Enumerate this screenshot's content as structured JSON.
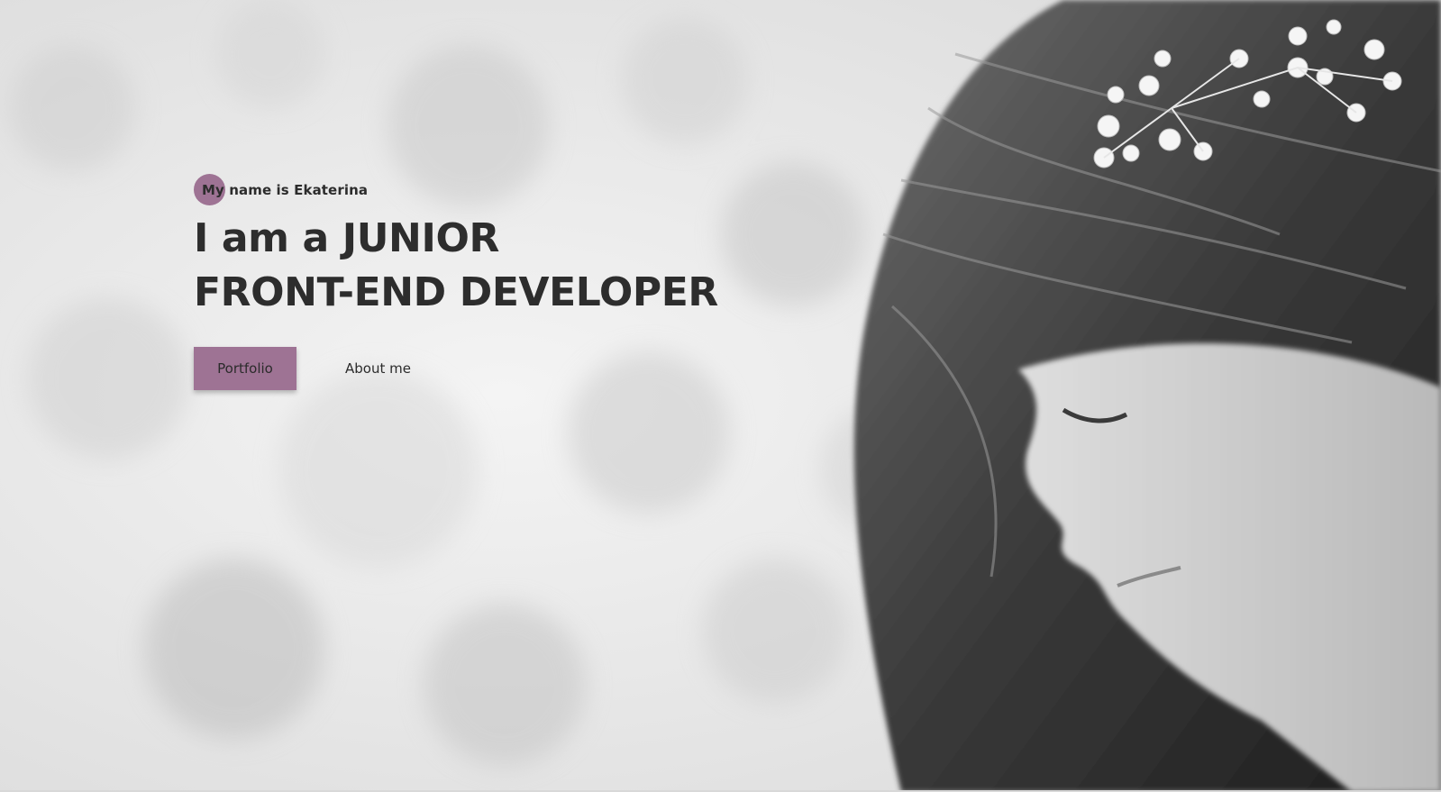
{
  "hero": {
    "subtitle": "My name is Ekaterina",
    "headline_line1": "I am a JUNIOR",
    "headline_line2": "FRONT-END DEVELOPER",
    "portfolio_label": "Portfolio",
    "about_label": "About me"
  },
  "colors": {
    "accent": "#9e7394",
    "text": "#2d2d2d"
  },
  "background": {
    "image": "black-and-white portrait photo",
    "icon": "woman-portrait-photo"
  }
}
